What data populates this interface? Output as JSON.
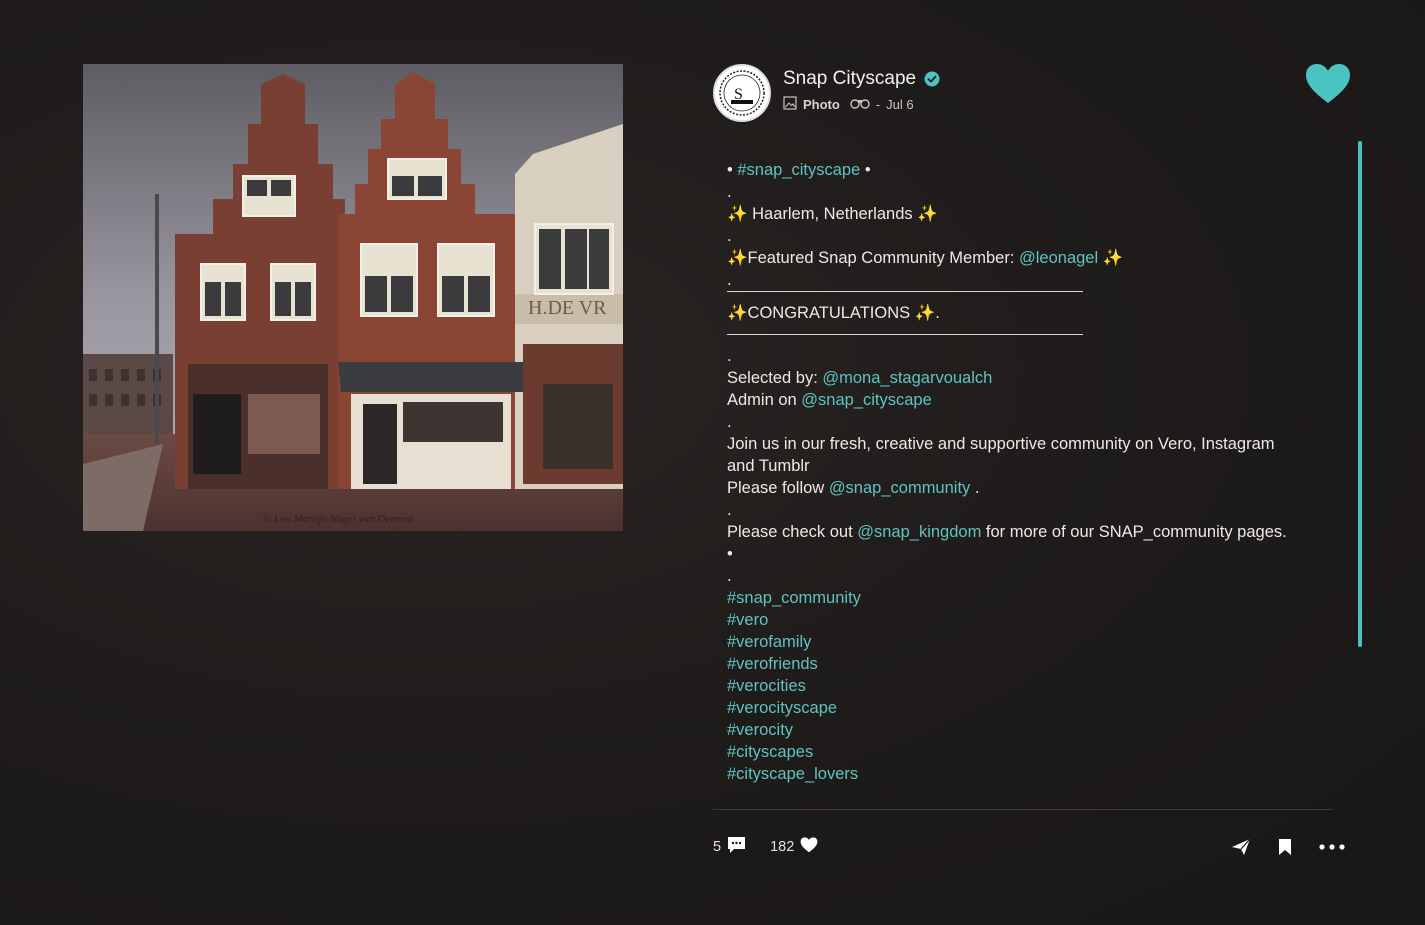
{
  "post": {
    "account_name": "Snap Cityscape",
    "type_label": "Photo",
    "date": "Jul 6",
    "date_separator": "-",
    "avatar_letter": "S",
    "photo_watermark": "© Leo Martijn Nagel van Deemen",
    "storefront_sign": "H.DE VR"
  },
  "caption": {
    "lines": [
      {
        "pre": "• ",
        "link": "#snap_cityscape",
        "post": "  •"
      },
      {
        "text": "."
      },
      {
        "text": "✨ Haarlem, Netherlands ✨"
      },
      {
        "text": "."
      },
      {
        "pre": "✨Featured Snap Community Member: ",
        "link": "@leonagel",
        "post": " ✨"
      },
      {
        "text": "."
      },
      {
        "text": "✨CONGRATULATIONS ✨."
      },
      {
        "text": "."
      },
      {
        "pre": "Selected by: ",
        "link": "@mona_stagarvoualch",
        "post": ""
      },
      {
        "pre": "Admin on ",
        "link": "@snap_cityscape",
        "post": ""
      },
      {
        "text": "."
      },
      {
        "text": "Join us in our fresh, creative and supportive community on Vero, Instagram and Tumblr"
      },
      {
        "pre": "Please follow ",
        "link": "@snap_community",
        "post": " ."
      },
      {
        "text": "."
      },
      {
        "pre": "Please check out ",
        "link": "@snap_kingdom",
        "post": " for more of our SNAP_community pages."
      },
      {
        "text": "•"
      },
      {
        "text": "."
      }
    ],
    "hashtags": [
      "#snap_community",
      "#vero",
      "#verofamily",
      "#verofriends",
      "#verocities",
      "#verocityscape",
      "#verocity",
      "#cityscapes",
      "#cityscape_lovers"
    ]
  },
  "stats": {
    "comments": "5",
    "likes": "182"
  },
  "colors": {
    "accent": "#4cc3c3",
    "link": "#5ec4c2",
    "background": "#1c1a1a"
  },
  "icons": {
    "verified": "verified-badge-icon",
    "photo": "photo-icon",
    "audience": "binoculars-icon",
    "like_top": "heart-icon",
    "comment": "comment-icon",
    "like": "heart-icon",
    "share": "send-icon",
    "save": "bookmark-icon",
    "more": "more-icon"
  }
}
